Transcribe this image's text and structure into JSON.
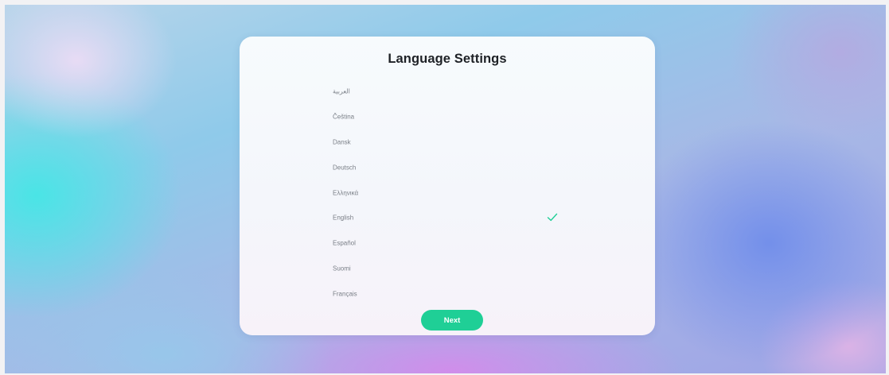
{
  "title": "Language Settings",
  "languages": [
    {
      "label": "العربية",
      "selected": false
    },
    {
      "label": "Čeština",
      "selected": false
    },
    {
      "label": "Dansk",
      "selected": false
    },
    {
      "label": "Deutsch",
      "selected": false
    },
    {
      "label": "Ελληνικά",
      "selected": false
    },
    {
      "label": "English",
      "selected": true
    },
    {
      "label": "Español",
      "selected": false
    },
    {
      "label": "Suomi",
      "selected": false
    },
    {
      "label": "Français",
      "selected": false
    }
  ],
  "selected_icon": "check-icon",
  "next_label": "Next",
  "colors": {
    "accent": "#1fcf96",
    "title_text": "#1e2126",
    "item_text": "#7a7f87",
    "card": "#f5f8fc"
  }
}
